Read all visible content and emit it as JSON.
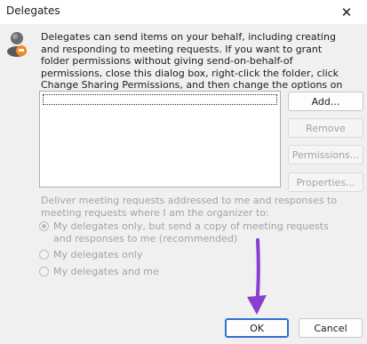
{
  "window": {
    "title": "Delegates",
    "close_glyph": "✕"
  },
  "description": "Delegates can send items on your behalf, including creating and responding to meeting requests. If you want to grant folder permissions without giving send-on-behalf-of permissions, close this dialog box, right-click the folder, click Change Sharing Permissions, and then change the options on the Permissions tab.",
  "buttons": {
    "add": "Add...",
    "remove": "Remove",
    "permissions": "Permissions...",
    "properties": "Properties...",
    "ok": "OK",
    "cancel": "Cancel"
  },
  "meeting_options": {
    "label": "Deliver meeting requests addressed to me and responses to meeting requests where I am the organizer to:",
    "options": [
      {
        "label": "My delegates only, but send a copy of meeting requests and responses to me (recommended)",
        "selected": true
      },
      {
        "label": "My delegates only",
        "selected": false
      },
      {
        "label": "My delegates and me",
        "selected": false
      }
    ]
  },
  "colors": {
    "dialog_bg": "#f0f0f0",
    "accent_border": "#2f6fd0",
    "annotation_arrow": "#8a3fd1"
  },
  "icons": {
    "user": "user-icon",
    "close": "close-icon",
    "annotation": "annotation-arrow-icon"
  }
}
